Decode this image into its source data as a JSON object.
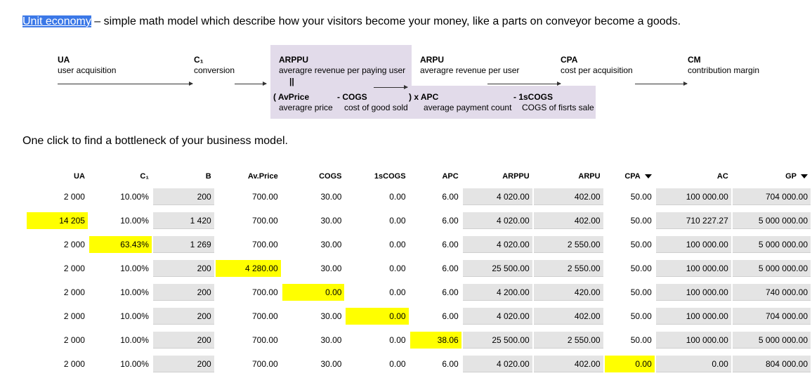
{
  "intro": {
    "highlight": "Unit economy",
    "rest": " – simple math model which describe how your visitors become your money, like a parts on conveyor become a goods."
  },
  "diagram": {
    "ua": {
      "title": "UA",
      "sub": "user acquisition"
    },
    "c1": {
      "title": "C₁",
      "sub": "conversion"
    },
    "arppu": {
      "title": "ARPPU",
      "sub": "averagre revenue per paying user",
      "equals": "||"
    },
    "arpu": {
      "title": "ARPU",
      "sub": "averagre revenue per user"
    },
    "cpa": {
      "title": "CPA",
      "sub": "cost per acquisition"
    },
    "cm": {
      "title": "CM",
      "sub": "contribution margin"
    },
    "avprice": {
      "title": "( AvPrice",
      "sub": "averagre price"
    },
    "cogs": {
      "title": "- COGS",
      "sub": "cost of good sold"
    },
    "apc": {
      "title": ") x APC",
      "sub": "average payment count"
    },
    "first_cogs": {
      "title": "- 1sCOGS",
      "sub": "COGS of fisrts sale"
    }
  },
  "subtitle": "One click to find a bottleneck of your business model.",
  "colors": {
    "highlight": "#ffff00",
    "computed": "#e4e4e4",
    "link": "#3b78e7",
    "diagram_shade": "#e2dbea"
  },
  "table": {
    "headers": [
      "UA",
      "C₁",
      "B",
      "Av.Price",
      "COGS",
      "1sCOGS",
      "APC",
      "ARPPU",
      "ARPU",
      "CPA",
      "AC",
      "GP"
    ],
    "sortable": [
      "CPA",
      "GP"
    ],
    "rows": [
      {
        "cells": [
          "2 000",
          "10.00%",
          "200",
          "700.00",
          "30.00",
          "0.00",
          "6.00",
          "4 020.00",
          "402.00",
          "50.00",
          "100 000.00",
          "704 000.00"
        ],
        "highlight": -1
      },
      {
        "cells": [
          "14 205",
          "10.00%",
          "1 420",
          "700.00",
          "30.00",
          "0.00",
          "6.00",
          "4 020.00",
          "402.00",
          "50.00",
          "710 227.27",
          "5 000 000.00"
        ],
        "highlight": 0
      },
      {
        "cells": [
          "2 000",
          "63.43%",
          "1 269",
          "700.00",
          "30.00",
          "0.00",
          "6.00",
          "4 020.00",
          "2 550.00",
          "50.00",
          "100 000.00",
          "5 000 000.00"
        ],
        "highlight": 1
      },
      {
        "cells": [
          "2 000",
          "10.00%",
          "200",
          "4 280.00",
          "30.00",
          "0.00",
          "6.00",
          "25 500.00",
          "2 550.00",
          "50.00",
          "100 000.00",
          "5 000 000.00"
        ],
        "highlight": 3
      },
      {
        "cells": [
          "2 000",
          "10.00%",
          "200",
          "700.00",
          "0.00",
          "0.00",
          "6.00",
          "4 200.00",
          "420.00",
          "50.00",
          "100 000.00",
          "740 000.00"
        ],
        "highlight": 4
      },
      {
        "cells": [
          "2 000",
          "10.00%",
          "200",
          "700.00",
          "30.00",
          "0.00",
          "6.00",
          "4 020.00",
          "402.00",
          "50.00",
          "100 000.00",
          "704 000.00"
        ],
        "highlight": 5
      },
      {
        "cells": [
          "2 000",
          "10.00%",
          "200",
          "700.00",
          "30.00",
          "0.00",
          "38.06",
          "25 500.00",
          "2 550.00",
          "50.00",
          "100 000.00",
          "5 000 000.00"
        ],
        "highlight": 6
      },
      {
        "cells": [
          "2 000",
          "10.00%",
          "200",
          "700.00",
          "30.00",
          "0.00",
          "6.00",
          "4 020.00",
          "402.00",
          "0.00",
          "0.00",
          "804 000.00"
        ],
        "highlight": 9
      }
    ]
  }
}
